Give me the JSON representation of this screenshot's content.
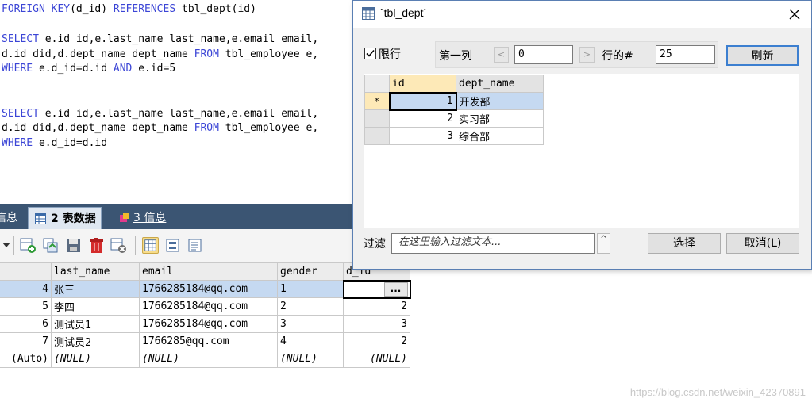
{
  "editor": {
    "lines": [
      {
        "parts": [
          {
            "t": "FOREIGN KEY",
            "k": true
          },
          {
            "t": "(d_id) ",
            "k": false
          },
          {
            "t": "REFERENCES",
            "k": true
          },
          {
            "t": " tbl_dept(id)",
            "k": false
          }
        ]
      },
      {
        "parts": [
          {
            "t": "SELECT",
            "k": true
          },
          {
            "t": " e.id id,e.last_name last_name,e.email email,",
            "k": false
          }
        ]
      },
      {
        "parts": [
          {
            "t": "d.id did,d.dept_name dept_name ",
            "k": false
          },
          {
            "t": "FROM",
            "k": true
          },
          {
            "t": " tbl_employee e,",
            "k": false
          }
        ]
      },
      {
        "parts": [
          {
            "t": "WHERE",
            "k": true
          },
          {
            "t": " e.d_id=d.id ",
            "k": false
          },
          {
            "t": "AND",
            "k": true
          },
          {
            "t": " e.id=5",
            "k": false
          }
        ]
      },
      {
        "parts": [
          {
            "t": "SELECT",
            "k": true
          },
          {
            "t": " e.id id,e.last_name last_name,e.email email,",
            "k": false
          }
        ]
      },
      {
        "parts": [
          {
            "t": "d.id did,d.dept_name dept_name ",
            "k": false
          },
          {
            "t": "FROM",
            "k": true
          },
          {
            "t": " tbl_employee e,",
            "k": false
          }
        ]
      },
      {
        "parts": [
          {
            "t": "WHERE",
            "k": true
          },
          {
            "t": " e.d_id=d.id",
            "k": false
          }
        ]
      }
    ]
  },
  "result_tabs": {
    "tab1": "信息",
    "tab2": "2 表数据",
    "tab3": "3 信息"
  },
  "employee_grid": {
    "columns": [
      "last_name",
      "email",
      "gender",
      "d_id"
    ],
    "rows": [
      {
        "id": "4",
        "last_name": "张三",
        "email": "1766285184@qq.com",
        "gender": "1",
        "d_id": "..."
      },
      {
        "id": "5",
        "last_name": "李四",
        "email": "1766285184@qq.com",
        "gender": "2",
        "d_id": "2"
      },
      {
        "id": "6",
        "last_name": "测试员1",
        "email": "1766285184@qq.com",
        "gender": "3",
        "d_id": "3"
      },
      {
        "id": "7",
        "last_name": "测试员2",
        "email": "1766285@qq.com",
        "gender": "4",
        "d_id": "2"
      },
      {
        "id": "(Auto)",
        "last_name": "(NULL)",
        "email": "(NULL)",
        "gender": "(NULL)",
        "d_id": "(NULL)"
      }
    ]
  },
  "dialog": {
    "title": "`tbl_dept`",
    "limit_label": "限行",
    "limit_checked": true,
    "first_row_label": "第一列",
    "first_row_value": "0",
    "rows_label": "行的#",
    "rows_value": "25",
    "refresh_label": "刷新",
    "columns": [
      "id",
      "dept_name"
    ],
    "rows": [
      {
        "marker": "*",
        "id": "1",
        "dept_name": "开发部"
      },
      {
        "marker": "",
        "id": "2",
        "dept_name": "实习部"
      },
      {
        "marker": "",
        "id": "3",
        "dept_name": "综合部"
      }
    ],
    "filter_label": "过滤",
    "filter_placeholder": "在这里输入过滤文本...",
    "select_label": "选择",
    "cancel_label": "取消(L)"
  },
  "watermark": "https://blog.csdn.net/weixin_42370891",
  "colors": {
    "keyword": "#3b45d6",
    "tab_bar": "#3b5573",
    "selected_row": "#c5d9f1",
    "highlight_header": "#fde9b7"
  }
}
